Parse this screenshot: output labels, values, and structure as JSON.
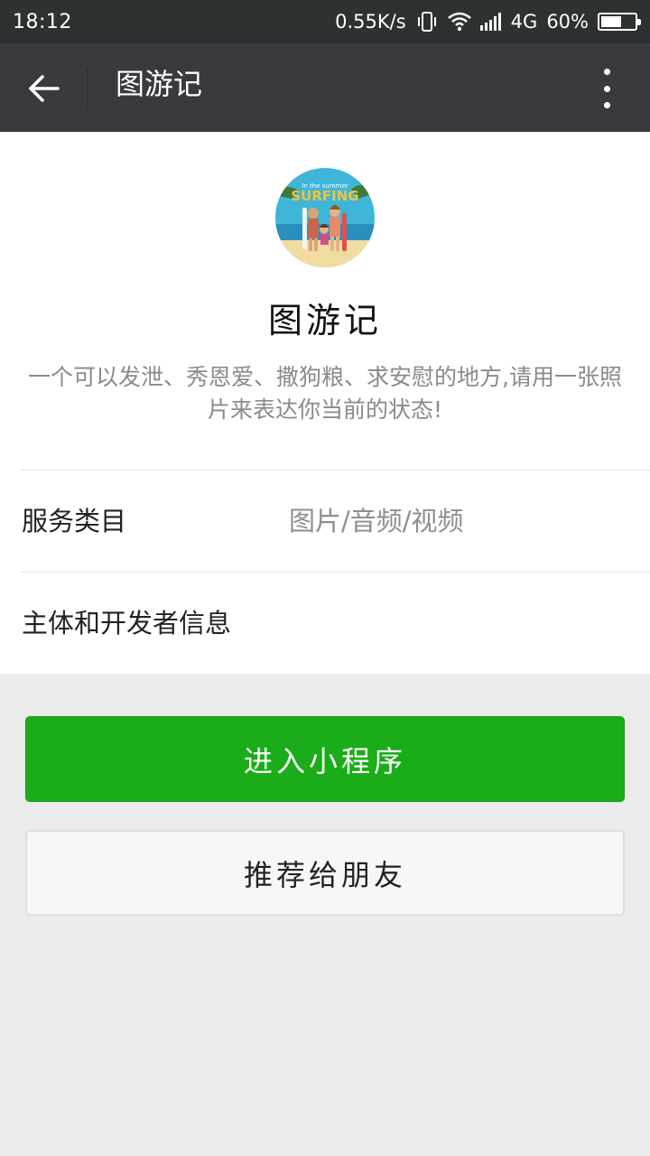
{
  "status_bar": {
    "time": "18:12",
    "network_speed": "0.55K/s",
    "network_type": "4G",
    "battery_text": "60%",
    "battery_level": 0.6,
    "icons": [
      "vibrate-icon",
      "wifi-icon",
      "signal-icon",
      "battery-icon"
    ]
  },
  "navbar": {
    "title": "图游记",
    "back_icon": "arrow-left-icon",
    "more_icon": "more-vertical-icon"
  },
  "app": {
    "name": "图游记",
    "description": "一个可以发泄、秀恩爱、撒狗粮、求安慰的地方,请用一张照片来表达你当前的状态!",
    "avatar_text": "In the summer SURFING"
  },
  "info": {
    "category_label": "服务类目",
    "category_value": "图片/音频/视频",
    "developer_label": "主体和开发者信息"
  },
  "actions": {
    "enter_label": "进入小程序",
    "share_label": "推荐给朋友"
  },
  "colors": {
    "statusbar_bg": "#2e3132",
    "navbar_bg": "#393a3f",
    "primary_green": "#1aad19",
    "page_bg": "#ebebeb"
  }
}
